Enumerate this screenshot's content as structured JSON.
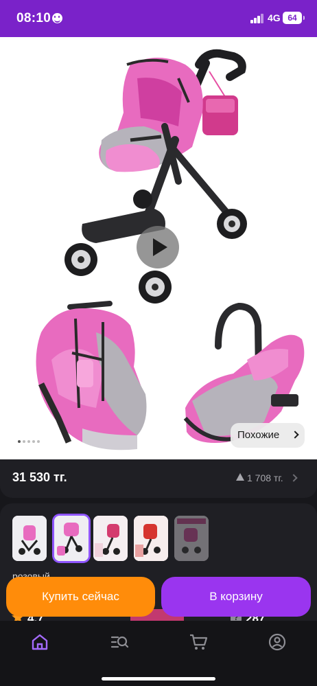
{
  "status_bar": {
    "time": "08:10",
    "network": "4G",
    "battery": "64"
  },
  "gallery": {
    "similar_label": "Похожие",
    "dots_count": 5,
    "active_dot": 0
  },
  "price": {
    "amount": "31 530 тг.",
    "delta": "1 708 тг."
  },
  "variants": {
    "thumbnails": [
      "variant-1",
      "variant-2",
      "variant-3",
      "variant-4",
      "variant-5"
    ],
    "selected_index": 1,
    "color_label": "розовый"
  },
  "rating": {
    "value": "4.7",
    "questions_count": "287"
  },
  "actions": {
    "buy_now": "Купить сейчас",
    "add_to_cart": "В корзину"
  },
  "bottom_nav": {
    "items": [
      {
        "icon": "home-icon",
        "active": true
      },
      {
        "icon": "catalog-search-icon",
        "active": false
      },
      {
        "icon": "cart-icon",
        "active": false
      },
      {
        "icon": "profile-icon",
        "active": false
      }
    ]
  },
  "colors": {
    "accent": "#7a22c9",
    "buy_now": "#ff8c0a",
    "add_to_cart": "#9a35ef",
    "active_nav": "#a56bff"
  }
}
